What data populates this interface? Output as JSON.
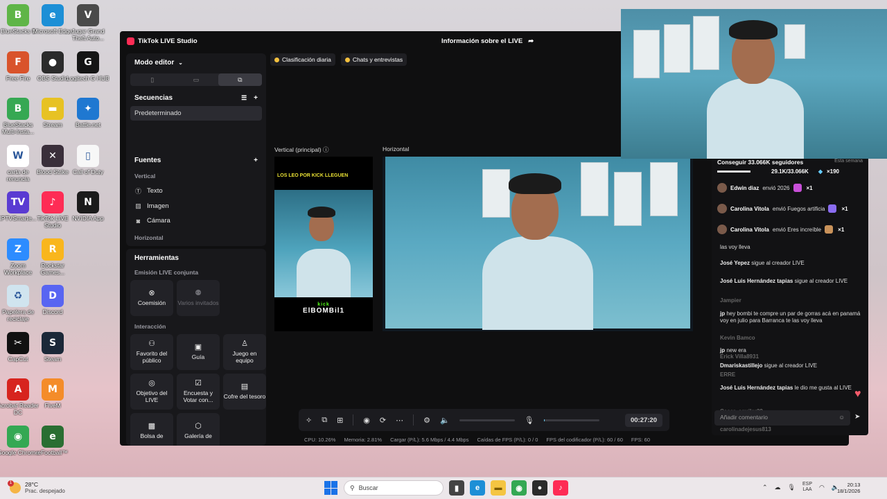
{
  "desktop": {
    "icons": [
      {
        "label": "BlueStacks 5",
        "color": "#5fb547",
        "glyph": "B"
      },
      {
        "label": "Microsoft Edge",
        "color": "#1d8fd6",
        "glyph": "e"
      },
      {
        "label": "Jugar Grand Theft Auto...",
        "color": "#4a4a4a",
        "glyph": "V"
      },
      {
        "label": "Free Fire",
        "color": "#d9532b",
        "glyph": "F"
      },
      {
        "label": "OBS Studio",
        "color": "#2b2b2b",
        "glyph": "●"
      },
      {
        "label": "Logitech G HUB",
        "color": "#151515",
        "glyph": "G"
      },
      {
        "label": "BlueStacks Multi-Insta...",
        "color": "#36a853",
        "glyph": "B"
      },
      {
        "label": "Stream",
        "color": "#e7c223",
        "glyph": "▬"
      },
      {
        "label": "Battle.net",
        "color": "#1f78d1",
        "glyph": "✦"
      },
      {
        "label": "carta de renuncia",
        "color": "#ffffff",
        "glyph": "W"
      },
      {
        "label": "Blood Strike",
        "color": "#3a2f3a",
        "glyph": "✕"
      },
      {
        "label": "Call of Duty",
        "color": "#f7f7f7",
        "glyph": "▯"
      },
      {
        "label": "IPTVSmarte...",
        "color": "#5a3bd2",
        "glyph": "TV"
      },
      {
        "label": "TikTok LIVE Studio",
        "color": "#fe2c55",
        "glyph": "♪"
      },
      {
        "label": "NVIDIA App",
        "color": "#1b1b1b",
        "glyph": "N"
      },
      {
        "label": "Zoom Workplace",
        "color": "#2d8cff",
        "glyph": "Z"
      },
      {
        "label": "Rockstar Games...",
        "color": "#f9b61d",
        "glyph": "R"
      },
      {
        "label": "Papelera de reciclaje",
        "color": "#d0e4ef",
        "glyph": "♻"
      },
      {
        "label": "Discord",
        "color": "#5865f2",
        "glyph": "D"
      },
      {
        "label": "CapCut",
        "color": "#111111",
        "glyph": "✂"
      },
      {
        "label": "Steam",
        "color": "#1b2838",
        "glyph": "S"
      },
      {
        "label": "Acrobat Reader DC",
        "color": "#d7241e",
        "glyph": "A"
      },
      {
        "label": "FiveM",
        "color": "#f48c2a",
        "glyph": "M"
      },
      {
        "label": "Google Chrome",
        "color": "#34a853",
        "glyph": "◉"
      },
      {
        "label": "eFootball™",
        "color": "#2a6e32",
        "glyph": "e"
      }
    ]
  },
  "studio": {
    "app_title": "TikTok LIVE Studio",
    "live_info": "Información sobre el LIVE",
    "mode_label": "Modo editor",
    "sequences_label": "Secuencias",
    "default_sequence": "Predeterminado",
    "sources_label": "Fuentes",
    "vertical_label": "Vertical",
    "sources": [
      "Texto",
      "Imagen",
      "Cámara"
    ],
    "horizontal_label": "Horizontal",
    "tools_label": "Herramientas",
    "joint_label": "Emisión LIVE conjunta",
    "joint_tiles": [
      "Coemisión",
      "Varios invitados"
    ],
    "interaction_label": "Interacción",
    "interaction_tiles": [
      "Favorito del público",
      "Guía",
      "Juego en equipo",
      "Objetivo del LIVE",
      "Encuesta y Votar con...",
      "Cofre del tesoro",
      "Bolsa de",
      "Galería de"
    ],
    "tags": [
      "Clasificación diaria",
      "Chats y entrevistas"
    ],
    "canvas_vertical": "Vertical (principal)",
    "canvas_horizontal": "Horizontal",
    "overlay_banner": "LOS LEO POR KICK LLEGUEN",
    "overlay_logo_top": "kick",
    "overlay_logo": "ElBOMBil1",
    "timer": "00:27:20",
    "stats": {
      "cpu": "CPU: 10.26%",
      "memory": "Memoria: 2.81%",
      "upload": "Cargar (P/L): 5.6 Mbps / 4.4 Mbps",
      "fps_drops": "Caídas de FPS (P/L): 0 / 0",
      "encoder_fps": "FPS del codificador (P/L): 60 / 60",
      "fps": "FPS: 60"
    },
    "mic_level": 0.02
  },
  "chat": {
    "goal_title": "Conseguir 33.066K seguidores",
    "goal_period": "Esta semana",
    "goal_progress": "29.1K/33.066K",
    "goal_reward": "×190",
    "gifts": [
      {
        "user": "Edwin diaz",
        "text": "envió 2026",
        "count": "×1",
        "color": "#c84fd8"
      },
      {
        "user": "Carolina Vitola",
        "text": "envió Fuegos artificia",
        "count": "×1",
        "color": "#8a6cf0"
      },
      {
        "user": "Carolina Vitola",
        "text": "envió Eres increíble",
        "count": "×1",
        "color": "#c9925a"
      }
    ],
    "messages": [
      {
        "user": "",
        "text": "las voy lleva"
      },
      {
        "user": "José Yepez",
        "text": "sigue al creador LIVE"
      },
      {
        "user": "José Luis Hernández tapias",
        "text": "sigue al creador LIVE"
      },
      {
        "user": "Jampier",
        "text": ""
      },
      {
        "user": "jp",
        "text": "hey bombi te compre un par de gorras acá en panamá voy en julio para Barranca te las voy lleva"
      },
      {
        "user": "Kevin Bamco",
        "text": ""
      },
      {
        "user": "jp",
        "text": "new era"
      },
      {
        "user": "Erick Villa8931",
        "text": ""
      },
      {
        "user": "Dmariskastillejo",
        "text": "sigue al creador LIVE"
      },
      {
        "user": "ERRE",
        "text": ""
      },
      {
        "user": "José Luis Hernández tapias",
        "text": "le dio me gusta al LIVE"
      },
      {
        "user": "Cesar_aguilar29",
        "text": ""
      },
      {
        "user": "carolinadejesus813",
        "text": ""
      }
    ],
    "input_placeholder": "Añadir comentario"
  },
  "taskbar": {
    "temperature": "28°C",
    "weather": "Prac. despejado",
    "weather_badge": "1",
    "search_placeholder": "Buscar",
    "lang_top": "ESP",
    "lang_bottom": "LAA",
    "time": "20:13",
    "date": "18/1/2026"
  }
}
